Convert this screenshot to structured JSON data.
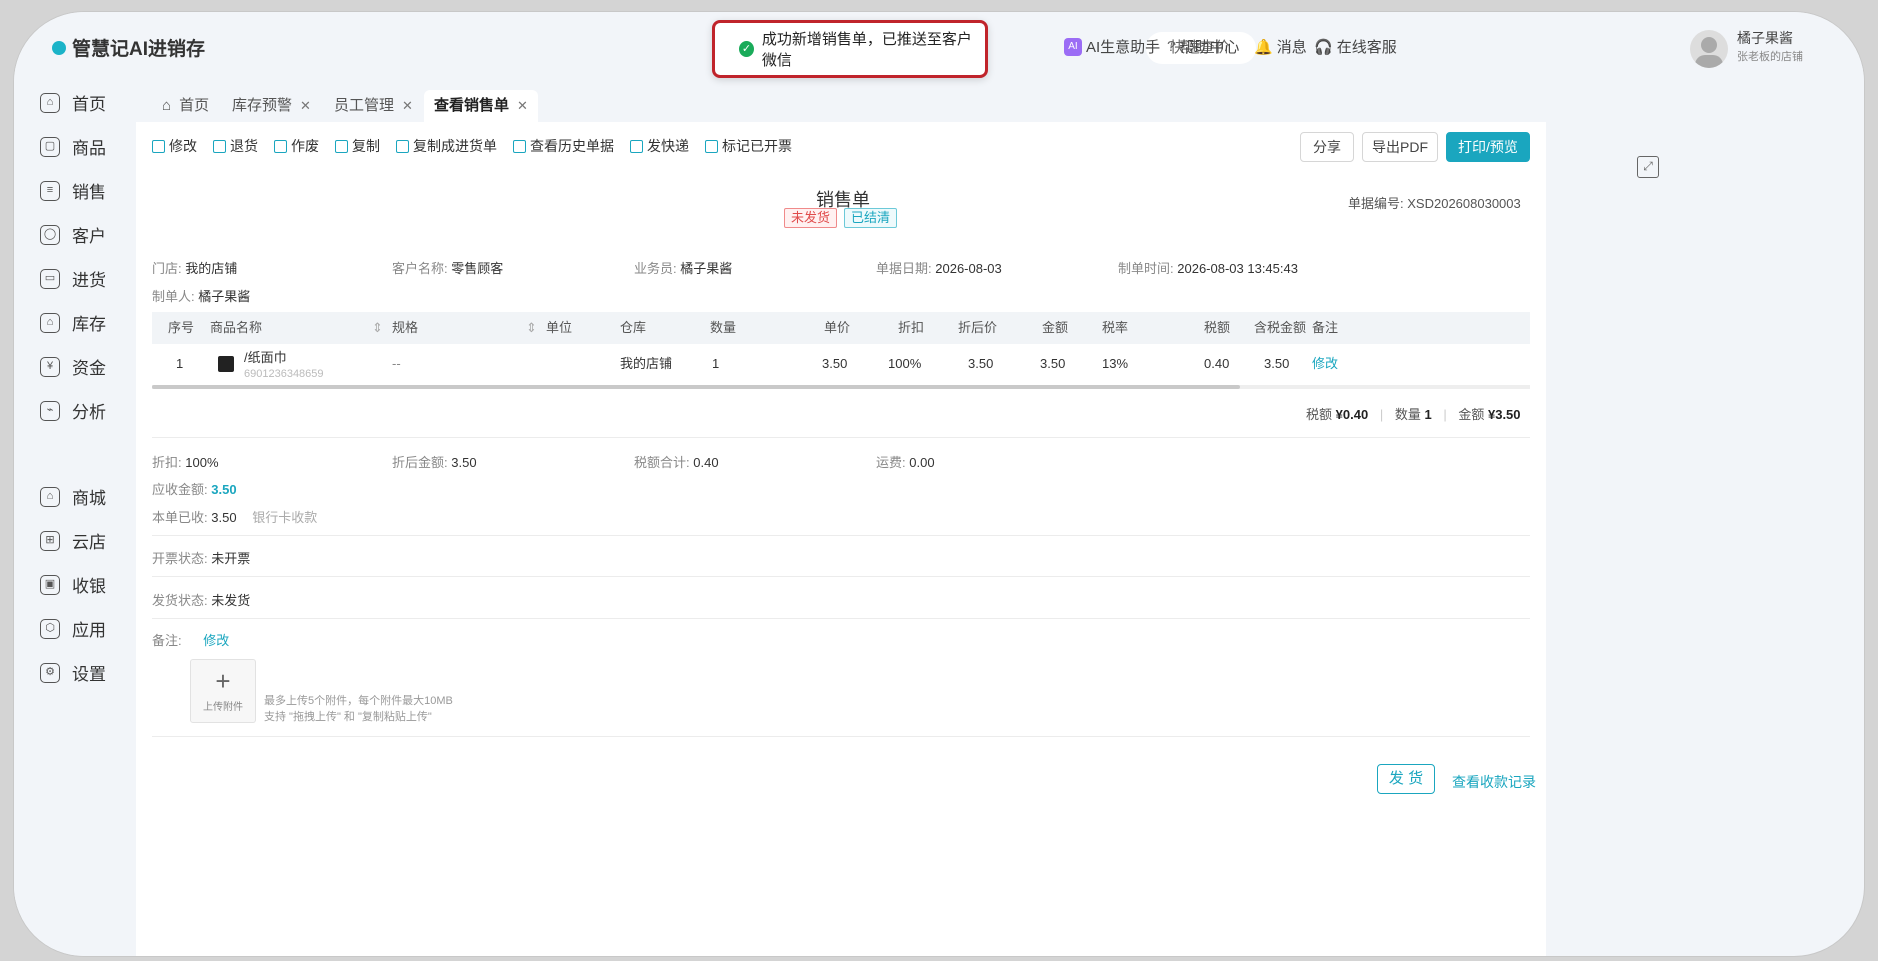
{
  "app": {
    "logo": "管慧记AI进销存"
  },
  "toast": {
    "text": "成功新增销售单，已推送至客户微信"
  },
  "topbar": {
    "search_text": "快速查价",
    "ai_label": "AI生意助手",
    "help_label": "帮助中心",
    "msg_label": "消息",
    "service_label": "在线客服",
    "user_name": "橘子果酱",
    "user_sub": "张老板的店铺"
  },
  "sidebar": {
    "items": [
      {
        "label": "首页"
      },
      {
        "label": "商品"
      },
      {
        "label": "销售"
      },
      {
        "label": "客户"
      },
      {
        "label": "进货"
      },
      {
        "label": "库存"
      },
      {
        "label": "资金"
      },
      {
        "label": "分析"
      },
      {
        "label": "商城"
      },
      {
        "label": "云店"
      },
      {
        "label": "收银"
      },
      {
        "label": "应用"
      },
      {
        "label": "设置"
      }
    ]
  },
  "tabs": [
    {
      "label": "首页"
    },
    {
      "label": "库存预警"
    },
    {
      "label": "员工管理"
    },
    {
      "label": "查看销售单"
    }
  ],
  "toolbar": {
    "items": [
      "修改",
      "退货",
      "作废",
      "复制",
      "复制成进货单",
      "查看历史单据",
      "发快递",
      "标记已开票"
    ],
    "share": "分享",
    "export_pdf": "导出PDF",
    "print": "打印/预览"
  },
  "doc": {
    "title": "销售单",
    "badge_shipping": "未发货",
    "badge_settled": "已结清",
    "number_label": "单据编号:",
    "number": "XSD202608030003",
    "store_label": "门店:",
    "store": "我的店铺",
    "customer_label": "客户名称:",
    "customer": "零售顾客",
    "salesman_label": "业务员:",
    "salesman": "橘子果酱",
    "date_label": "单据日期:",
    "date": "2026-08-03",
    "created_label": "制单时间:",
    "created": "2026-08-03 13:45:43",
    "creator_label": "制单人:",
    "creator": "橘子果酱"
  },
  "table": {
    "headers": [
      "序号",
      "商品名称",
      "规格",
      "单位",
      "仓库",
      "数量",
      "单价",
      "折扣",
      "折后价",
      "金额",
      "税率",
      "税额",
      "含税金额",
      "备注"
    ],
    "row": {
      "seq": "1",
      "name": "/纸面巾",
      "barcode": "6901236348659",
      "spec": "--",
      "unit": "",
      "warehouse": "我的店铺",
      "qty": "1",
      "price": "3.50",
      "discount": "100%",
      "disc_price": "3.50",
      "amount": "3.50",
      "tax_rate": "13%",
      "tax": "0.40",
      "tax_amount": "3.50",
      "edit": "修改"
    }
  },
  "totals": {
    "tax_label": "税额",
    "tax": "¥0.40",
    "qty_label": "数量",
    "qty": "1",
    "amount_label": "金额",
    "amount": "¥3.50"
  },
  "summary": {
    "discount_label": "折扣:",
    "discount": "100%",
    "after_label": "折后金额:",
    "after": "3.50",
    "tax_total_label": "税额合计:",
    "tax_total": "0.40",
    "freight_label": "运费:",
    "freight": "0.00",
    "receivable_label": "应收金额:",
    "receivable": "3.50",
    "received_label": "本单已收:",
    "received": "3.50",
    "method": "银行卡收款",
    "invoice_label": "开票状态:",
    "invoice": "未开票",
    "ship_label": "发货状态:",
    "ship": "未发货",
    "remark_label": "备注:",
    "remark_edit": "修改"
  },
  "upload": {
    "label": "上传附件",
    "hint1": "最多上传5个附件，每个附件最大10MB",
    "hint2": "支持 \"拖拽上传\" 和 \"复制粘贴上传\""
  },
  "footer": {
    "deliver": "发 货",
    "view_receipts": "查看收款记录"
  },
  "colors": {
    "accent": "#1aa6bf",
    "toast_border": "#c0242b",
    "success": "#1aab5a"
  }
}
